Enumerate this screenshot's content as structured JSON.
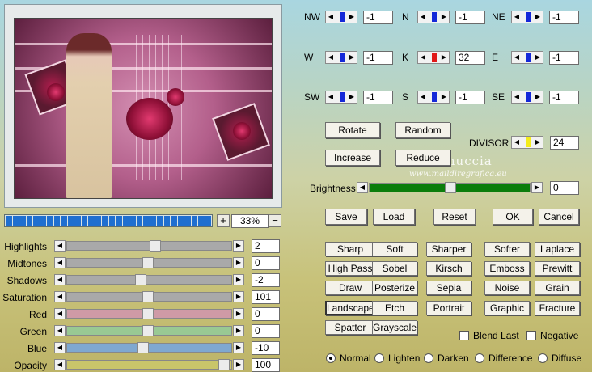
{
  "preview": {
    "zoom": "33%",
    "zoom_plus": "+",
    "zoom_minus": "−",
    "watermark_title": "Pinuccia",
    "watermark_url": "www.maildiregrafica.eu"
  },
  "directions": [
    {
      "id": "nw",
      "label": "NW",
      "value": "-1"
    },
    {
      "id": "n",
      "label": "N",
      "value": "-1"
    },
    {
      "id": "ne",
      "label": "NE",
      "value": "-1"
    },
    {
      "id": "w",
      "label": "W",
      "value": "-1"
    },
    {
      "id": "k",
      "label": "K",
      "value": "32"
    },
    {
      "id": "e",
      "label": "E",
      "value": "-1"
    },
    {
      "id": "sw",
      "label": "SW",
      "value": "-1"
    },
    {
      "id": "s",
      "label": "S",
      "value": "-1"
    },
    {
      "id": "se",
      "label": "SE",
      "value": "-1"
    }
  ],
  "actions": {
    "rotate": "Rotate",
    "random": "Random",
    "increase": "Increase",
    "reduce": "Reduce"
  },
  "divisor": {
    "label": "DIVISOR",
    "value": "24"
  },
  "brightness": {
    "label": "Brightness",
    "value": "0",
    "level": 0.5
  },
  "main_buttons": {
    "save": "Save",
    "load": "Load",
    "reset": "Reset",
    "ok": "OK",
    "cancel": "Cancel"
  },
  "adjustments": [
    {
      "id": "highlights",
      "label": "Highlights",
      "value": "2",
      "level": 0.55,
      "color": "#a9a9a9"
    },
    {
      "id": "midtones",
      "label": "Midtones",
      "value": "0",
      "level": 0.5,
      "color": "#a9a9a9"
    },
    {
      "id": "shadows",
      "label": "Shadows",
      "value": "-2",
      "level": 0.45,
      "color": "#a9a9a9"
    },
    {
      "id": "saturation",
      "label": "Saturation",
      "value": "101",
      "level": 0.5,
      "color": "#a9a9a9"
    },
    {
      "id": "red",
      "label": "Red",
      "value": "0",
      "level": 0.5,
      "color": "#cf9aa6"
    },
    {
      "id": "green",
      "label": "Green",
      "value": "0",
      "level": 0.5,
      "color": "#99c993"
    },
    {
      "id": "blue",
      "label": "Blue",
      "value": "-10",
      "level": 0.47,
      "color": "#7fa8d0"
    },
    {
      "id": "opacity",
      "label": "Opacity",
      "value": "100",
      "level": 1.0,
      "color": "#c9c56a"
    }
  ],
  "filters": [
    [
      "Sharp",
      "Soft",
      "Sharper",
      "Softer",
      "Laplace"
    ],
    [
      "High Pass",
      "Sobel",
      "Kirsch",
      "Emboss",
      "Prewitt"
    ],
    [
      "Draw",
      "Posterize",
      "Sepia",
      "Noise",
      "Grain"
    ],
    [
      "Landscape",
      "Etch",
      "Portrait",
      "Graphic",
      "Fracture"
    ],
    [
      "Spatter",
      "Grayscale"
    ]
  ],
  "options": {
    "blend_last": "Blend Last",
    "negative": "Negative"
  },
  "blend_modes": [
    "Normal",
    "Lighten",
    "Darken",
    "Difference",
    "Diffuse"
  ],
  "colors": {
    "indicator_blue": "#1428d8",
    "indicator_red": "#e01818",
    "indicator_yellow": "#f4ec1c",
    "brightness_track": "#0b7d0b"
  }
}
